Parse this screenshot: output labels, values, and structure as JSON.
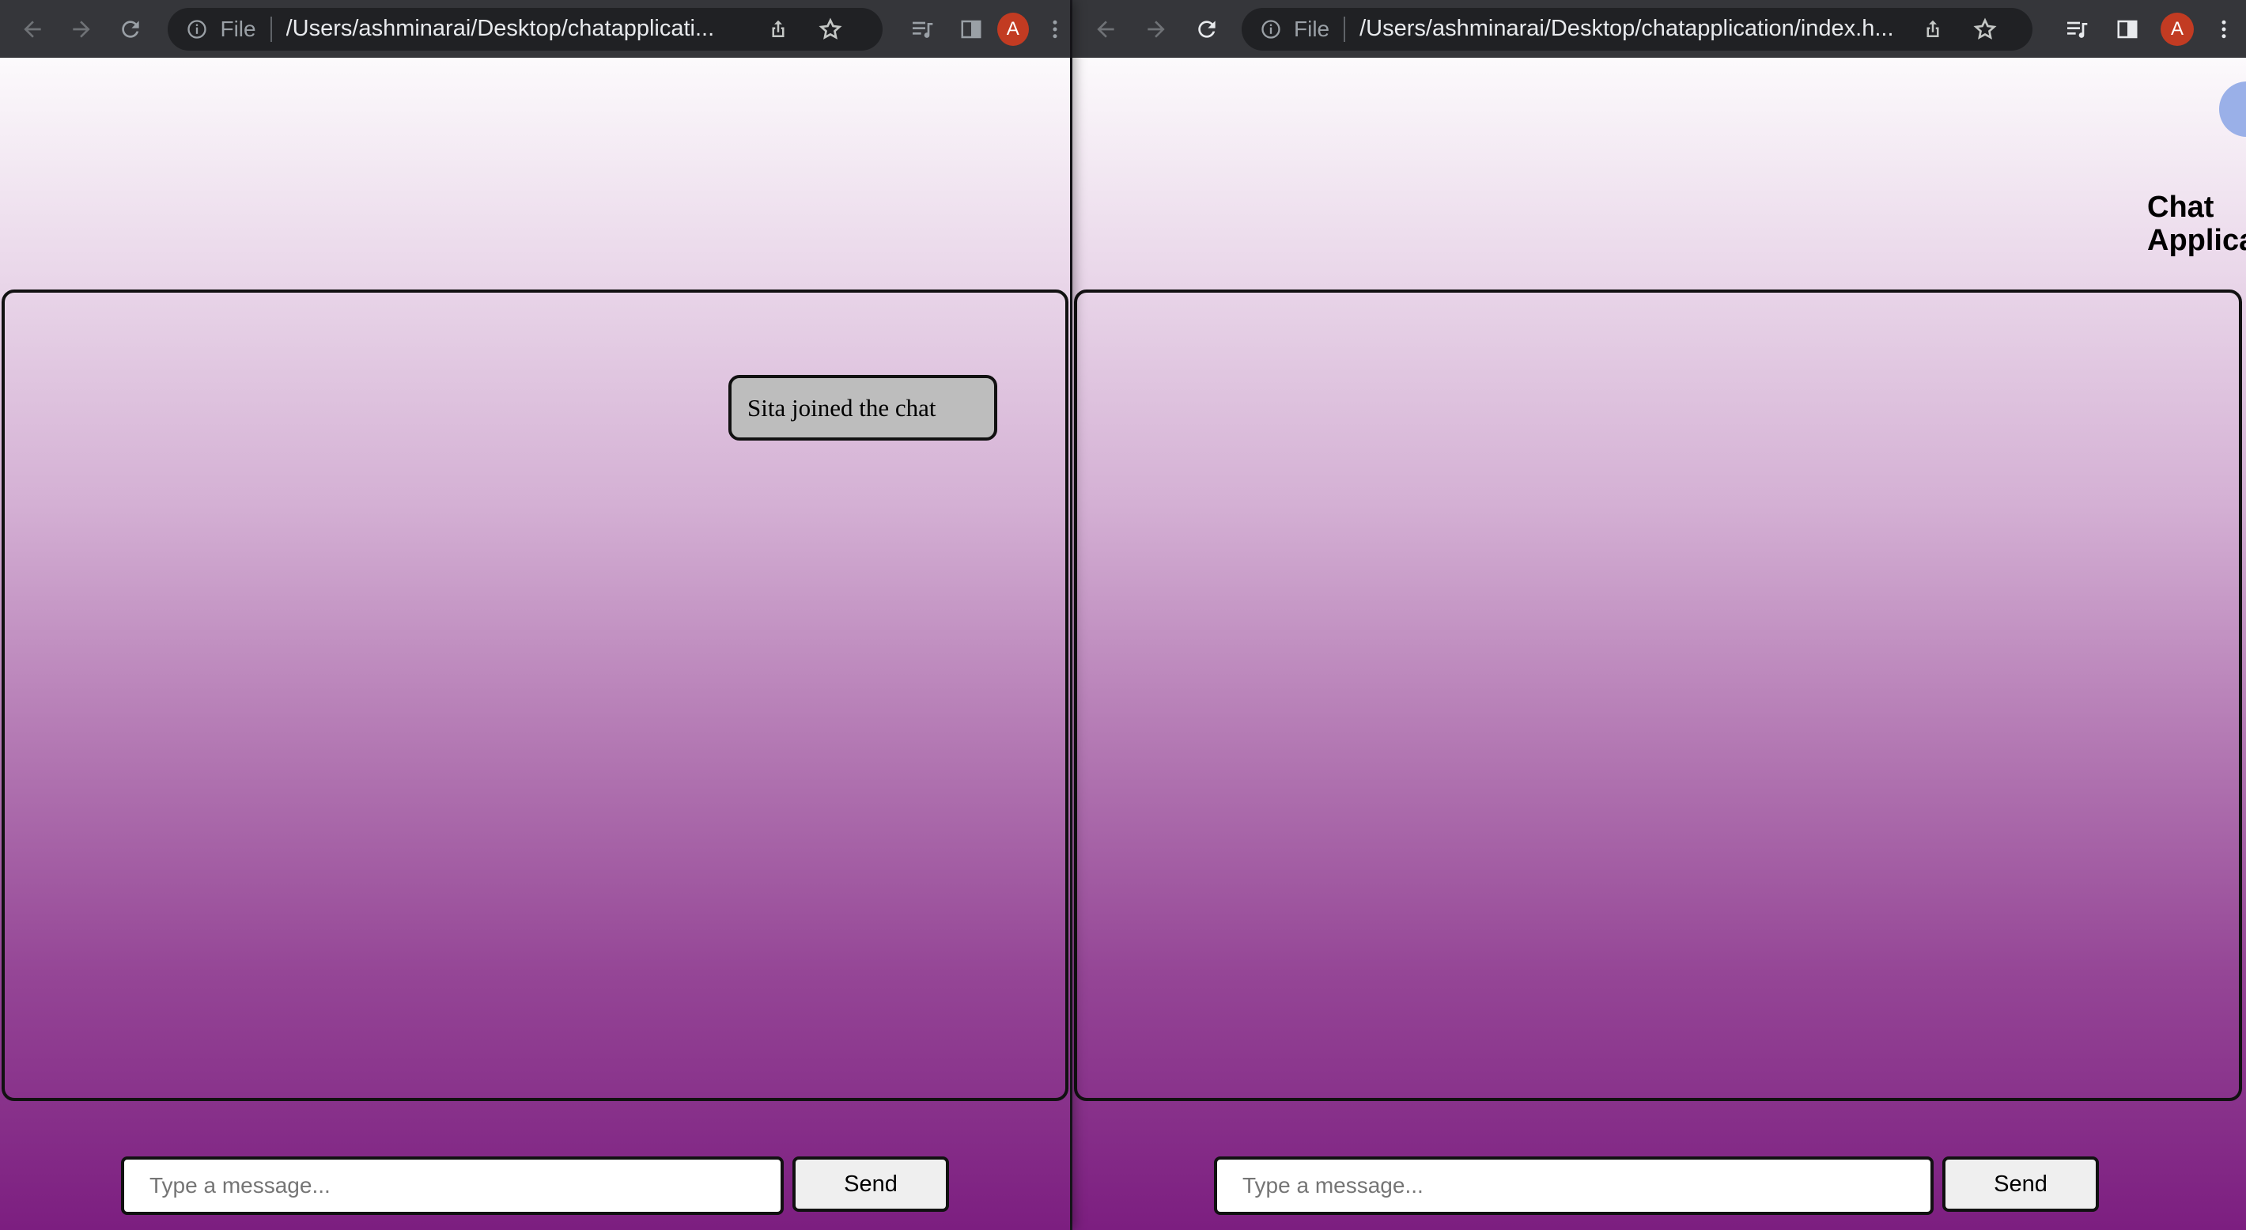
{
  "windows": {
    "left": {
      "url": "/Users/ashminarai/Desktop/chatapplicati...",
      "scheme_label": "File",
      "profile_initial": "A",
      "messages": [
        {
          "text": "Sita joined the chat"
        }
      ],
      "input_placeholder": "Type a message...",
      "send_label": "Send"
    },
    "right": {
      "url": "/Users/ashminarai/Desktop/chatapplication/index.h...",
      "scheme_label": "File",
      "profile_initial": "A",
      "app_title_line1": "Chat",
      "app_title_line2": "Applica",
      "input_placeholder": "Type a message...",
      "send_label": "Send"
    }
  },
  "colors": {
    "toolbar": "#35363a",
    "omnibox": "#202124",
    "avatar": "#c23b22",
    "gradient_top": "#fcfafc",
    "gradient_bottom": "#7c1e80",
    "message_bubble": "#bdbdbd"
  },
  "icons": [
    "back-arrow-icon",
    "forward-arrow-icon",
    "reload-icon",
    "info-icon",
    "share-icon",
    "bookmark-star-icon",
    "media-control-icon",
    "side-panel-icon",
    "kebab-menu-icon"
  ]
}
